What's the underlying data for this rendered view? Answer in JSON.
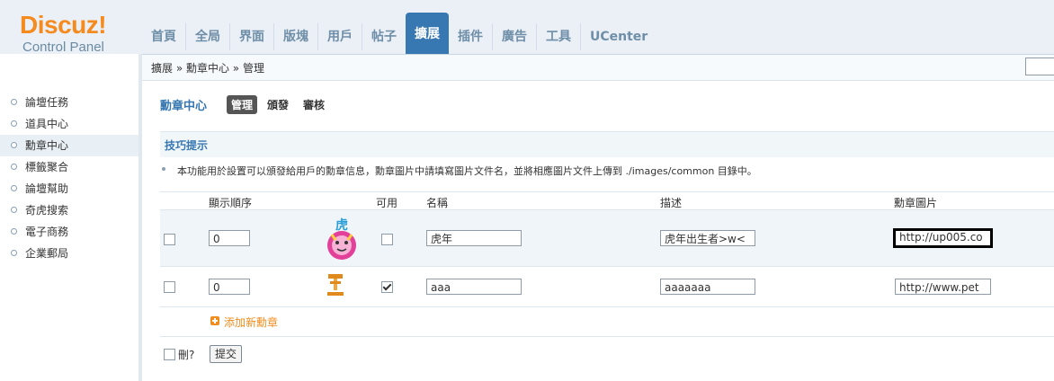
{
  "logo": {
    "word": "Discuz!",
    "sub": "Control Panel"
  },
  "nav": {
    "items": [
      "首頁",
      "全局",
      "界面",
      "版塊",
      "用戶",
      "帖子",
      "擴展",
      "插件",
      "廣告",
      "工具",
      "UCenter"
    ],
    "active": "擴展"
  },
  "breadcrumb": "擴展 » 勳章中心 » 管理",
  "sidebar": {
    "items": [
      "論壇任務",
      "道具中心",
      "勳章中心",
      "標籤聚合",
      "論壇幫助",
      "奇虎搜索",
      "電子商務",
      "企業郵局"
    ],
    "active": "勳章中心"
  },
  "main": {
    "title": "勳章中心",
    "subtabs": [
      "管理",
      "頒發",
      "審核"
    ],
    "tips_title": "技巧提示",
    "tip": "本功能用於設置可以頒發給用戶的勳章信息，勳章圖片中請填寫圖片文件名，並將相應圖片文件上傳到 ./images/common 目錄中。",
    "headers": {
      "order": "顯示順序",
      "enabled": "可用",
      "name": "名稱",
      "desc": "描述",
      "image": "勳章圖片"
    },
    "rows": [
      {
        "order": "0",
        "enabled": false,
        "name": "虎年",
        "desc": "虎年出生者>w<",
        "image": "http://up005.co",
        "icon": "tiger-icon",
        "icon_char": "虎"
      },
      {
        "order": "0",
        "enabled": true,
        "name": "aaa",
        "desc": "aaaaaaa",
        "image": "http://www.pet",
        "icon": "trophy-icon"
      }
    ],
    "add_label": "添加新勳章",
    "delete_label": "刪?",
    "submit_label": "提交"
  },
  "colors": {
    "accent": "#3777b2",
    "logo_orange": "#f58b1f",
    "add_orange": "#f08c1d"
  }
}
